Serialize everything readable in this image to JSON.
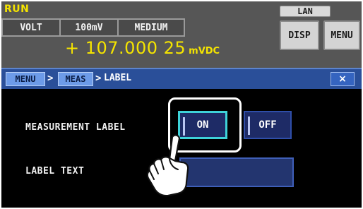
{
  "header": {
    "run_status": "RUN",
    "lan": "LAN",
    "function": "VOLT",
    "range": "100mV",
    "speed": "MEDIUM",
    "reading_value": "+ 107.000 25",
    "reading_unit": "mVDC",
    "disp_label": "DISP",
    "menu_label": "MENU"
  },
  "breadcrumb": {
    "items": [
      "MENU",
      "MEAS"
    ],
    "separator": ">",
    "current": "LABEL",
    "close_glyph": "×"
  },
  "settings": {
    "measurement_label": {
      "label": "MEASUREMENT LABEL",
      "on": "ON",
      "off": "OFF",
      "selected": "ON"
    },
    "label_text": {
      "label": "LABEL TEXT",
      "value": ""
    }
  },
  "icons": {
    "pointer": "hand-pointer-icon",
    "close": "close-icon"
  },
  "colors": {
    "reading": "#f5e400",
    "header_bg": "#565656",
    "breadcrumb_bg": "#2a4f99",
    "selected_outline": "#3ed2d8"
  }
}
